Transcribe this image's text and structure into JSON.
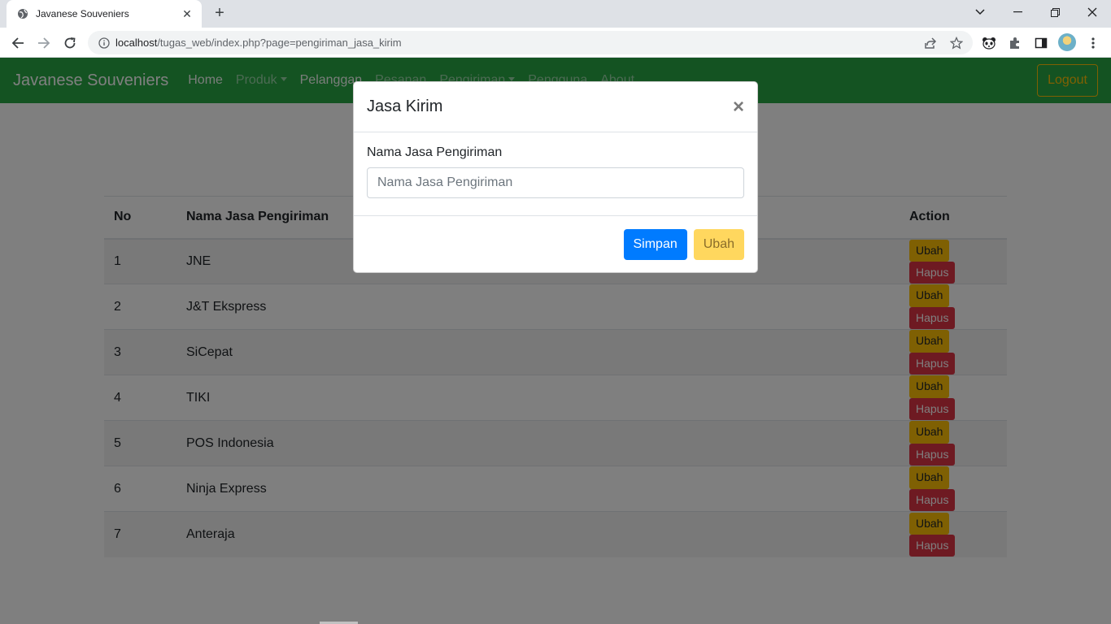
{
  "browser": {
    "tab_title": "Javanese Souveniers",
    "url_host": "localhost",
    "url_path": "/tugas_web/index.php?page=pengiriman_jasa_kirim"
  },
  "navbar": {
    "brand": "Javanese Souveniers",
    "links": [
      {
        "label": "Home"
      },
      {
        "label": "Produk"
      },
      {
        "label": "Pelanggan"
      },
      {
        "label": "Pesanan"
      },
      {
        "label": "Pengiriman"
      },
      {
        "label": "Pengguna"
      },
      {
        "label": "About"
      }
    ],
    "logout": "Logout"
  },
  "table": {
    "headers": {
      "no": "No",
      "name": "Nama Jasa Pengiriman",
      "action": "Action"
    },
    "edit_label": "Ubah",
    "delete_label": "Hapus",
    "rows": [
      {
        "no": "1",
        "name": "JNE"
      },
      {
        "no": "2",
        "name": "J&T Ekspress"
      },
      {
        "no": "3",
        "name": "SiCepat"
      },
      {
        "no": "4",
        "name": "TIKI"
      },
      {
        "no": "5",
        "name": "POS Indonesia"
      },
      {
        "no": "6",
        "name": "Ninja Express"
      },
      {
        "no": "7",
        "name": "Anteraja"
      }
    ]
  },
  "modal": {
    "title": "Jasa Kirim",
    "close": "×",
    "label": "Nama Jasa Pengiriman",
    "placeholder": "Nama Jasa Pengiriman",
    "save": "Simpan",
    "edit": "Ubah"
  },
  "colors": {
    "navbar": "#28a745",
    "primary": "#007bff",
    "warning": "#ffc107",
    "danger": "#dc3545"
  }
}
